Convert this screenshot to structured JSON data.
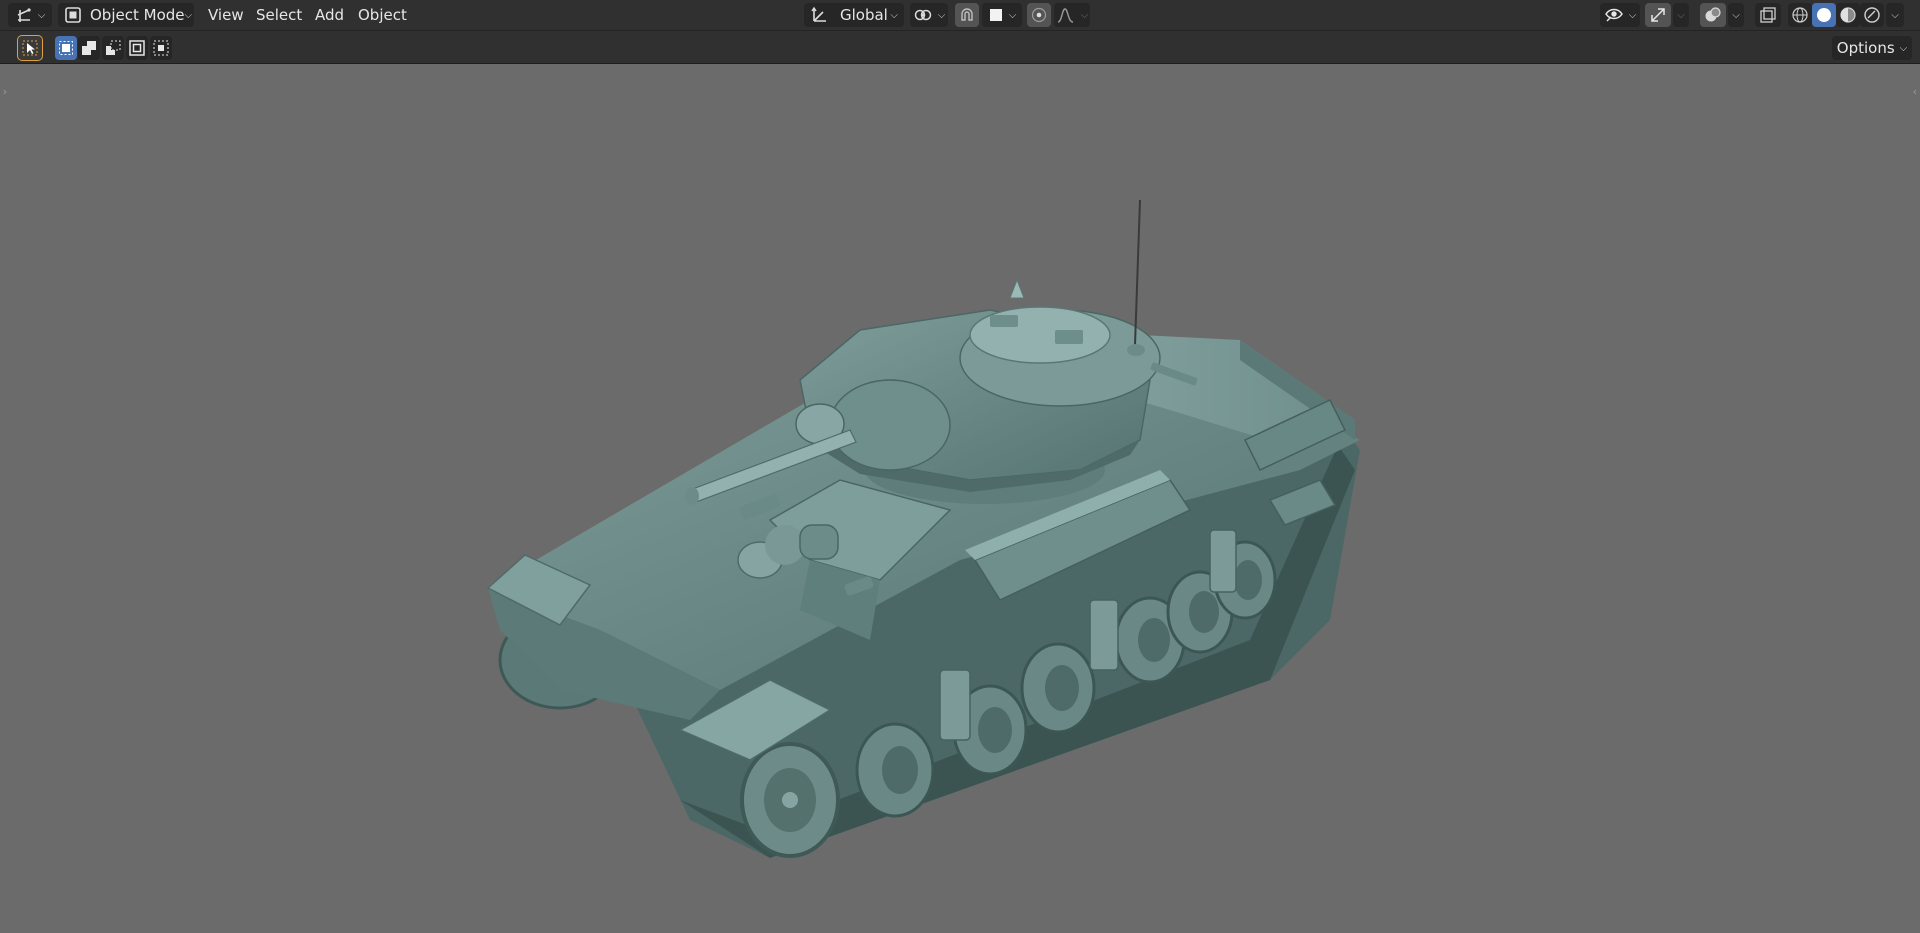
{
  "header": {
    "mode_label": "Object Mode",
    "menus": [
      "View",
      "Select",
      "Add",
      "Object"
    ],
    "orientation_label": "Global"
  },
  "toolbar": {
    "options_label": "Options"
  },
  "viewport": {
    "background_color": "#6b6b6b",
    "model_color": "#5f7f7d",
    "scene_object": "tank-model"
  },
  "colors": {
    "accent_blue": "#4772b3",
    "header_bg": "#303030",
    "select_outline": "#e0a040"
  },
  "icons": {
    "editor_type": "transform-axes-icon",
    "mode": "object-mode-icon",
    "orientation": "transform-orientation-icon",
    "pivot": "pivot-point-icon",
    "snap": "magnet-icon",
    "snap_target": "snap-increment-icon",
    "proportional": "proportional-edit-icon",
    "falloff": "falloff-curve-icon",
    "visibility": "eye-icon",
    "gizmo": "gizmo-icon",
    "overlays": "overlays-icon",
    "xray": "xray-icon",
    "shading_wire": "wireframe-shading-icon",
    "shading_solid": "solid-shading-icon",
    "shading_material": "material-shading-icon",
    "shading_rendered": "rendered-shading-icon",
    "select_tool": "select-cursor-icon",
    "select_new": "select-new-icon",
    "select_extend": "select-extend-icon",
    "select_subtract": "select-subtract-icon",
    "select_invert": "select-invert-icon",
    "select_intersect": "select-intersect-icon"
  }
}
